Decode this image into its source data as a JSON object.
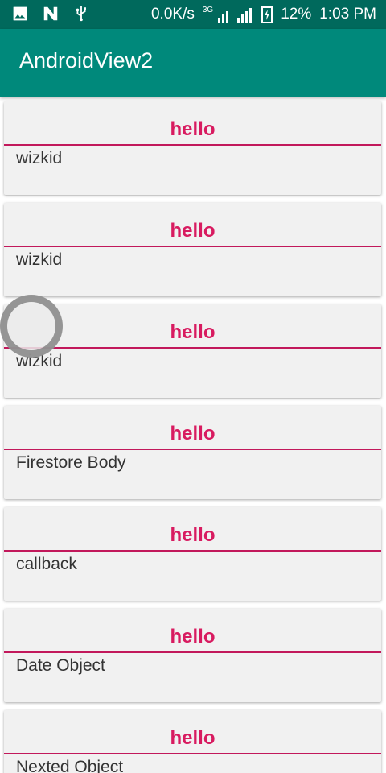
{
  "status_bar": {
    "network_speed": "0.0K/s",
    "network_type": "3G",
    "battery": "12%",
    "time": "1:03 PM",
    "icons": [
      "image-icon",
      "n-notification-icon",
      "usb-icon",
      "signal-icon",
      "battery-icon"
    ]
  },
  "app_bar": {
    "title": "AndroidView2",
    "color": "#00897b"
  },
  "cards": [
    {
      "title": "hello",
      "body": "wizkid"
    },
    {
      "title": "hello",
      "body": "wizkid"
    },
    {
      "title": "hello",
      "body": "wizkid"
    },
    {
      "title": "hello",
      "body": "Firestore Body"
    },
    {
      "title": "hello",
      "body": "callback"
    },
    {
      "title": "hello",
      "body": "Date Object"
    },
    {
      "title": "hello",
      "body": "Nexted Object"
    }
  ],
  "colors": {
    "accent": "#d81b60",
    "status_bar": "#00695c",
    "card_background": "#f1f1f1"
  }
}
